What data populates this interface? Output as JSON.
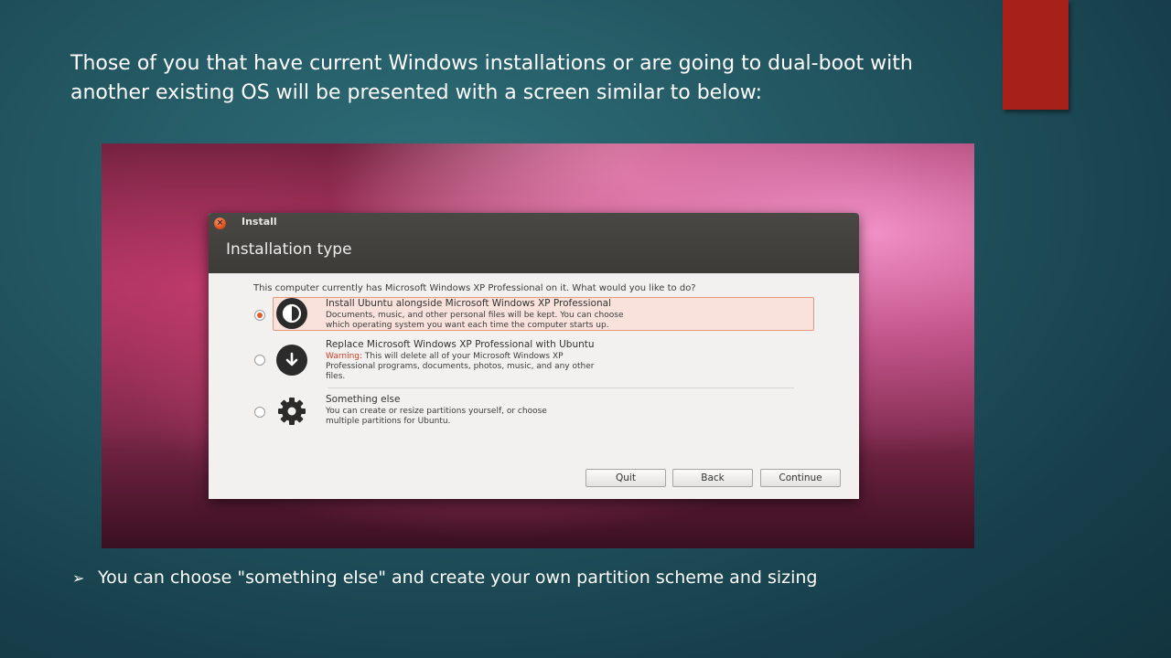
{
  "slide": {
    "heading": "Those of you that have current Windows installations or are going to dual-boot with another existing OS will be presented with a screen similar to below:",
    "bullet_marker": "➢",
    "bullet_text": "You can choose \"something else\" and create your own partition scheme and sizing",
    "accent_color": "#a8201a"
  },
  "installer": {
    "window_title": "Install",
    "heading": "Installation type",
    "question": "This computer currently has Microsoft Windows XP Professional on it. What would you like to do?",
    "options": [
      {
        "title": "Install Ubuntu alongside Microsoft Windows XP Professional",
        "desc_1": "Documents, music, and other personal files will be kept. You can choose",
        "desc_2": "which operating system you want each time the computer starts up.",
        "selected": true,
        "icon": "half-circle-icon"
      },
      {
        "title": "Replace Microsoft Windows XP Professional with Ubuntu",
        "warning_label": "Warning:",
        "desc_1": " This will delete all of your Microsoft Windows XP",
        "desc_2": "Professional programs, documents, photos, music, and any other",
        "desc_3": "files.",
        "selected": false,
        "icon": "down-arrow-icon"
      },
      {
        "title": "Something else",
        "desc_1": "You can create or resize partitions yourself, or choose",
        "desc_2": "multiple partitions for Ubuntu.",
        "selected": false,
        "icon": "gear-icon"
      }
    ],
    "buttons": {
      "quit": "Quit",
      "back": "Back",
      "continue": "Continue"
    },
    "selection_color": "#e05a2b"
  }
}
